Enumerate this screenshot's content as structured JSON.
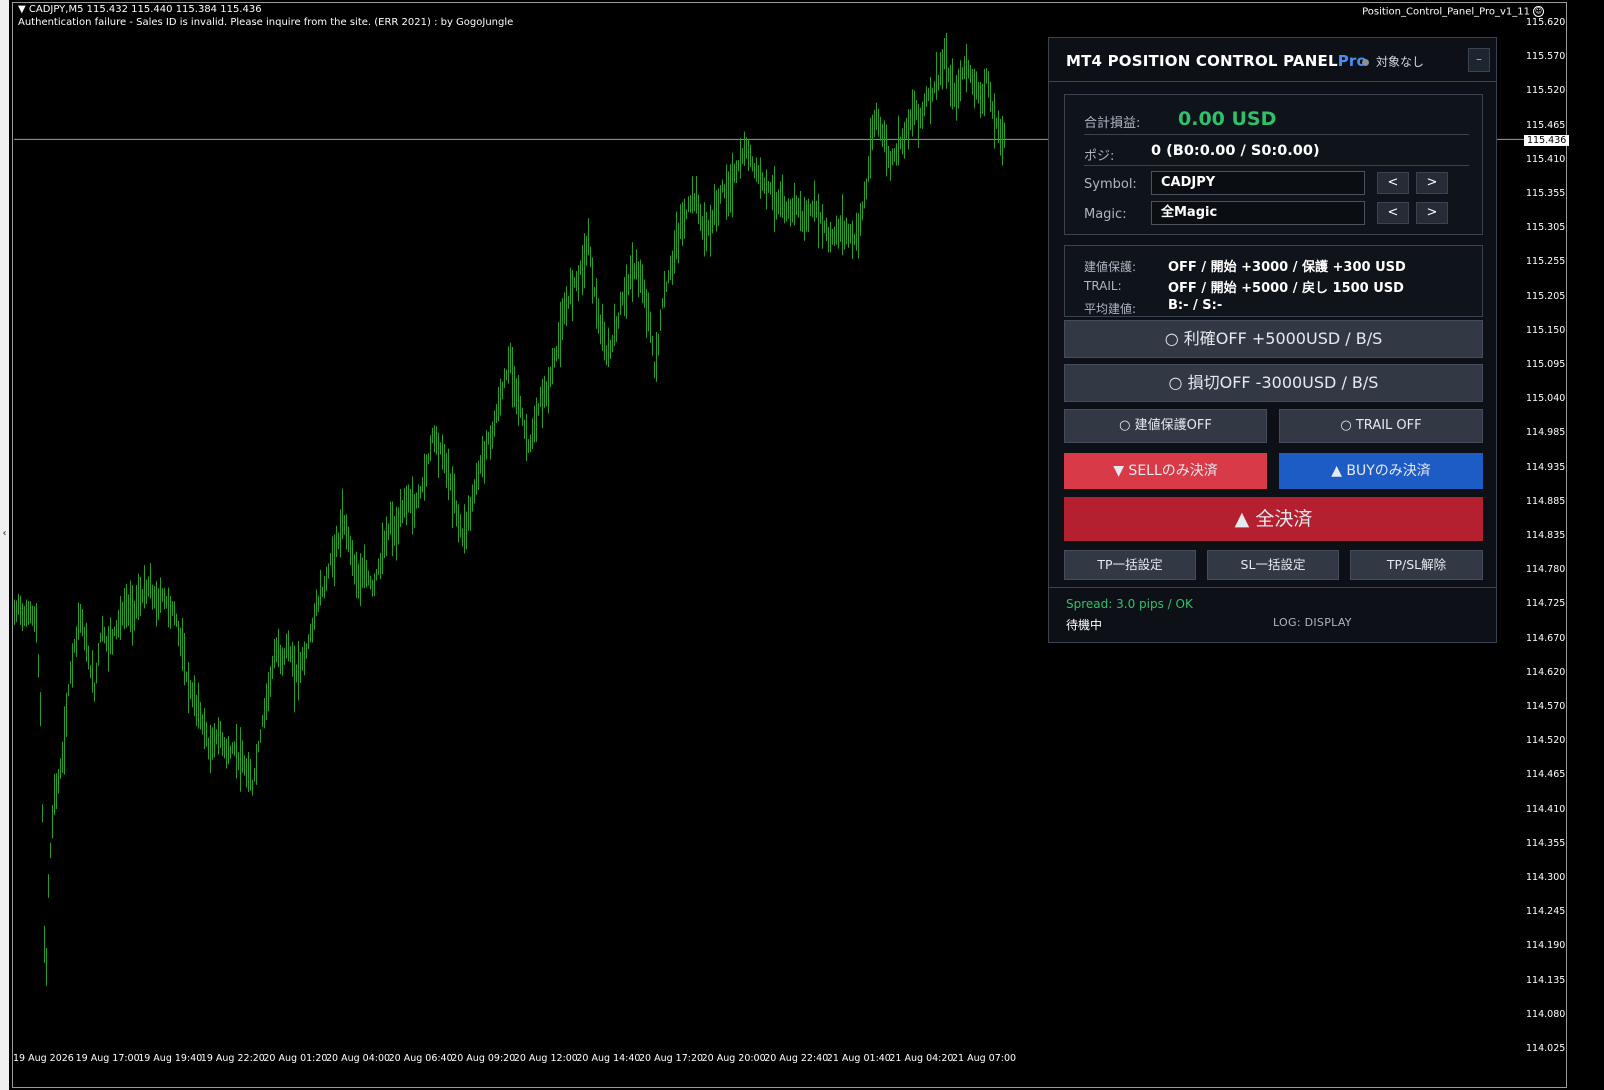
{
  "chart": {
    "header_line1": "CADJPY,M5  115.432 115.440 115.384 115.436",
    "header_line2": "Authentication failure - Sales ID is invalid. Please inquire from the site. (ERR 2021) : by GogoJungle",
    "indicator_name": "Position_Control_Panel_Pro_v1_11",
    "current_price": "115.436",
    "y_ticks": [
      "115.620",
      "115.570",
      "115.520",
      "115.465",
      "115.410",
      "115.355",
      "115.305",
      "115.255",
      "115.205",
      "115.150",
      "115.095",
      "115.040",
      "114.985",
      "114.935",
      "114.885",
      "114.835",
      "114.780",
      "114.725",
      "114.670",
      "114.620",
      "114.570",
      "114.520",
      "114.465",
      "114.410",
      "114.355",
      "114.300",
      "114.245",
      "114.190",
      "114.135",
      "114.080",
      "114.025"
    ],
    "x_ticks": [
      "19 Aug 2026",
      "19 Aug 17:00",
      "19 Aug 19:40",
      "19 Aug 22:20",
      "20 Aug 01:20",
      "20 Aug 04:00",
      "20 Aug 06:40",
      "20 Aug 09:20",
      "20 Aug 12:00",
      "20 Aug 14:40",
      "20 Aug 17:20",
      "20 Aug 20:00",
      "20 Aug 22:40",
      "21 Aug 01:40",
      "21 Aug 04:20",
      "21 Aug 07:00"
    ],
    "bar_color": "#2a9c2a",
    "price_path": [
      [
        0,
        114.695
      ],
      [
        5,
        114.715
      ],
      [
        10,
        114.69
      ],
      [
        16,
        114.705
      ],
      [
        22,
        114.68
      ],
      [
        26,
        114.55
      ],
      [
        29,
        114.3
      ],
      [
        31,
        114.06
      ],
      [
        33,
        114.25
      ],
      [
        36,
        114.33
      ],
      [
        40,
        114.42
      ],
      [
        45,
        114.44
      ],
      [
        50,
        114.5
      ],
      [
        55,
        114.6
      ],
      [
        60,
        114.65
      ],
      [
        66,
        114.7
      ],
      [
        70,
        114.66
      ],
      [
        75,
        114.62
      ],
      [
        80,
        114.58
      ],
      [
        84,
        114.64
      ],
      [
        88,
        114.68
      ],
      [
        92,
        114.65
      ],
      [
        97,
        114.66
      ],
      [
        102,
        114.68
      ],
      [
        106,
        114.69
      ],
      [
        112,
        114.71
      ],
      [
        118,
        114.7
      ],
      [
        124,
        114.72
      ],
      [
        130,
        114.73
      ],
      [
        136,
        114.74
      ],
      [
        142,
        114.71
      ],
      [
        148,
        114.73
      ],
      [
        154,
        114.71
      ],
      [
        160,
        114.7
      ],
      [
        166,
        114.66
      ],
      [
        172,
        114.6
      ],
      [
        178,
        114.57
      ],
      [
        184,
        114.55
      ],
      [
        190,
        114.52
      ],
      [
        196,
        114.48
      ],
      [
        202,
        114.51
      ],
      [
        208,
        114.5
      ],
      [
        214,
        114.48
      ],
      [
        220,
        114.49
      ],
      [
        226,
        114.47
      ],
      [
        232,
        114.45
      ],
      [
        238,
        114.43
      ],
      [
        244,
        114.49
      ],
      [
        250,
        114.55
      ],
      [
        256,
        114.6
      ],
      [
        262,
        114.64
      ],
      [
        268,
        114.63
      ],
      [
        274,
        114.65
      ],
      [
        280,
        114.6
      ],
      [
        286,
        114.62
      ],
      [
        292,
        114.64
      ],
      [
        298,
        114.68
      ],
      [
        304,
        114.72
      ],
      [
        310,
        114.74
      ],
      [
        316,
        114.78
      ],
      [
        322,
        114.8
      ],
      [
        328,
        114.84
      ],
      [
        334,
        114.82
      ],
      [
        340,
        114.77
      ],
      [
        346,
        114.75
      ],
      [
        352,
        114.76
      ],
      [
        358,
        114.74
      ],
      [
        364,
        114.77
      ],
      [
        370,
        114.8
      ],
      [
        376,
        114.84
      ],
      [
        382,
        114.82
      ],
      [
        388,
        114.86
      ],
      [
        394,
        114.88
      ],
      [
        400,
        114.86
      ],
      [
        406,
        114.89
      ],
      [
        412,
        114.92
      ],
      [
        418,
        114.98
      ],
      [
        424,
        114.96
      ],
      [
        430,
        114.94
      ],
      [
        436,
        114.9
      ],
      [
        442,
        114.86
      ],
      [
        448,
        114.82
      ],
      [
        454,
        114.85
      ],
      [
        460,
        114.89
      ],
      [
        466,
        114.93
      ],
      [
        472,
        114.96
      ],
      [
        478,
        114.98
      ],
      [
        484,
        115.02
      ],
      [
        490,
        115.06
      ],
      [
        496,
        115.09
      ],
      [
        502,
        115.05
      ],
      [
        508,
        115.0
      ],
      [
        514,
        114.96
      ],
      [
        520,
        114.98
      ],
      [
        526,
        115.03
      ],
      [
        532,
        115.04
      ],
      [
        538,
        115.08
      ],
      [
        544,
        115.12
      ],
      [
        550,
        115.16
      ],
      [
        556,
        115.2
      ],
      [
        562,
        115.22
      ],
      [
        568,
        115.24
      ],
      [
        574,
        115.28
      ],
      [
        580,
        115.2
      ],
      [
        586,
        115.14
      ],
      [
        592,
        115.1
      ],
      [
        598,
        115.12
      ],
      [
        604,
        115.16
      ],
      [
        610,
        115.2
      ],
      [
        616,
        115.22
      ],
      [
        622,
        115.24
      ],
      [
        628,
        115.2
      ],
      [
        634,
        115.17
      ],
      [
        640,
        115.08
      ],
      [
        644,
        115.12
      ],
      [
        648,
        115.18
      ],
      [
        654,
        115.22
      ],
      [
        660,
        115.26
      ],
      [
        666,
        115.3
      ],
      [
        672,
        115.32
      ],
      [
        678,
        115.35
      ],
      [
        684,
        115.33
      ],
      [
        690,
        115.29
      ],
      [
        696,
        115.3
      ],
      [
        702,
        115.33
      ],
      [
        708,
        115.36
      ],
      [
        714,
        115.35
      ],
      [
        720,
        115.38
      ],
      [
        726,
        115.4
      ],
      [
        732,
        115.42
      ],
      [
        738,
        115.4
      ],
      [
        744,
        115.38
      ],
      [
        750,
        115.37
      ],
      [
        756,
        115.36
      ],
      [
        762,
        115.34
      ],
      [
        768,
        115.33
      ],
      [
        774,
        115.32
      ],
      [
        780,
        115.34
      ],
      [
        786,
        115.32
      ],
      [
        792,
        115.31
      ],
      [
        798,
        115.33
      ],
      [
        804,
        115.32
      ],
      [
        810,
        115.3
      ],
      [
        816,
        115.28
      ],
      [
        822,
        115.29
      ],
      [
        828,
        115.3
      ],
      [
        834,
        115.29
      ],
      [
        840,
        115.28
      ],
      [
        846,
        115.31
      ],
      [
        852,
        115.36
      ],
      [
        858,
        115.44
      ],
      [
        862,
        115.47
      ],
      [
        866,
        115.46
      ],
      [
        870,
        115.43
      ],
      [
        876,
        115.4
      ],
      [
        882,
        115.42
      ],
      [
        888,
        115.44
      ],
      [
        894,
        115.46
      ],
      [
        900,
        115.48
      ],
      [
        906,
        115.47
      ],
      [
        912,
        115.5
      ],
      [
        918,
        115.51
      ],
      [
        924,
        115.53
      ],
      [
        930,
        115.56
      ],
      [
        936,
        115.52
      ],
      [
        942,
        115.5
      ],
      [
        948,
        115.54
      ],
      [
        954,
        115.55
      ],
      [
        960,
        115.52
      ],
      [
        966,
        115.5
      ],
      [
        972,
        115.53
      ],
      [
        978,
        115.48
      ],
      [
        984,
        115.45
      ],
      [
        990,
        115.436
      ]
    ]
  },
  "panel": {
    "title_main": "MT4 POSITION CONTROL PANEL",
    "title_pro": "Pro",
    "status": "対象なし",
    "minimize": "–",
    "pnl_label": "合計損益:",
    "pnl_value": "0.00 USD",
    "pnl_color": "#31c06a",
    "pos_label": "ポジ:",
    "pos_value": "0 (B0:0.00 / S0:0.00)",
    "symbol_label": "Symbol:",
    "symbol_value": "CADJPY",
    "magic_label": "Magic:",
    "magic_value": "全Magic",
    "prev": "<",
    "next": ">",
    "be_label": "建値保護:",
    "be_value": "OFF / 開始 +3000 / 保護 +300 USD",
    "trail_label": "TRAIL:",
    "trail_value": "OFF / 開始 +5000 / 戻し 1500 USD",
    "avg_label": "平均建値:",
    "avg_value": "B:- / S:-",
    "tp_btn": "○ 利確OFF +5000USD / B/S",
    "sl_btn": "○ 損切OFF -3000USD / B/S",
    "be_btn": "○ 建値保護OFF",
    "trail_btn": "○ TRAIL OFF",
    "sell_close": "▼ SELLのみ決済",
    "buy_close": "▲ BUYのみ決済",
    "close_all": "▲  全決済",
    "tp_bulk": "TP一括設定",
    "sl_bulk": "SL一括設定",
    "tpsl_clear": "TP/SL解除",
    "spread": "Spread: 3.0 pips / OK",
    "state": "待機中",
    "log": "LOG: DISPLAY",
    "sell_color": "#d83a48",
    "buy_color": "#1d5cc4",
    "close_color": "#b4202f"
  }
}
